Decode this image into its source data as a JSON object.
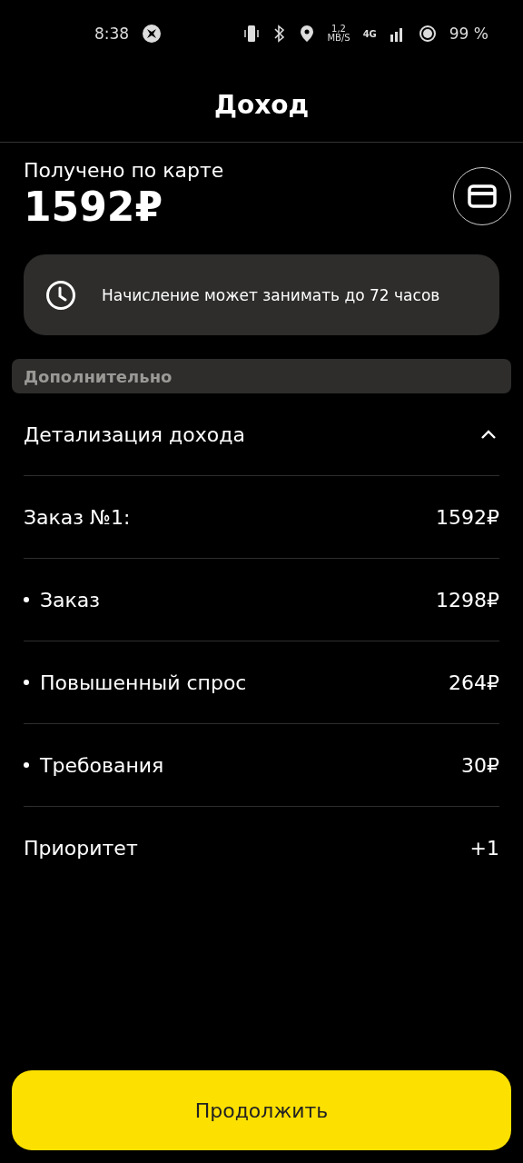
{
  "status_bar": {
    "time": "8:38",
    "speed": "1,2",
    "speed_unit": "MB/S",
    "network": "4G",
    "battery": "99 %"
  },
  "title": "Доход",
  "summary": {
    "label": "Получено по карте",
    "amount": "1592₽"
  },
  "notice": {
    "text": "Начисление может занимать до 72 часов"
  },
  "section": {
    "title": "Дополнительно"
  },
  "details": {
    "title": "Детализация дохода",
    "expanded": true
  },
  "rows": [
    {
      "kind": "item",
      "label": "Заказ №1:",
      "value": "1592₽"
    },
    {
      "kind": "sub",
      "label": "Заказ",
      "value": "1298₽"
    },
    {
      "kind": "sub",
      "label": "Повышенный спрос",
      "value": "264₽"
    },
    {
      "kind": "sub",
      "label": "Требования",
      "value": "30₽"
    },
    {
      "kind": "item",
      "label": "Приоритет",
      "value": "+1"
    }
  ],
  "button": {
    "label": "Продолжить"
  }
}
